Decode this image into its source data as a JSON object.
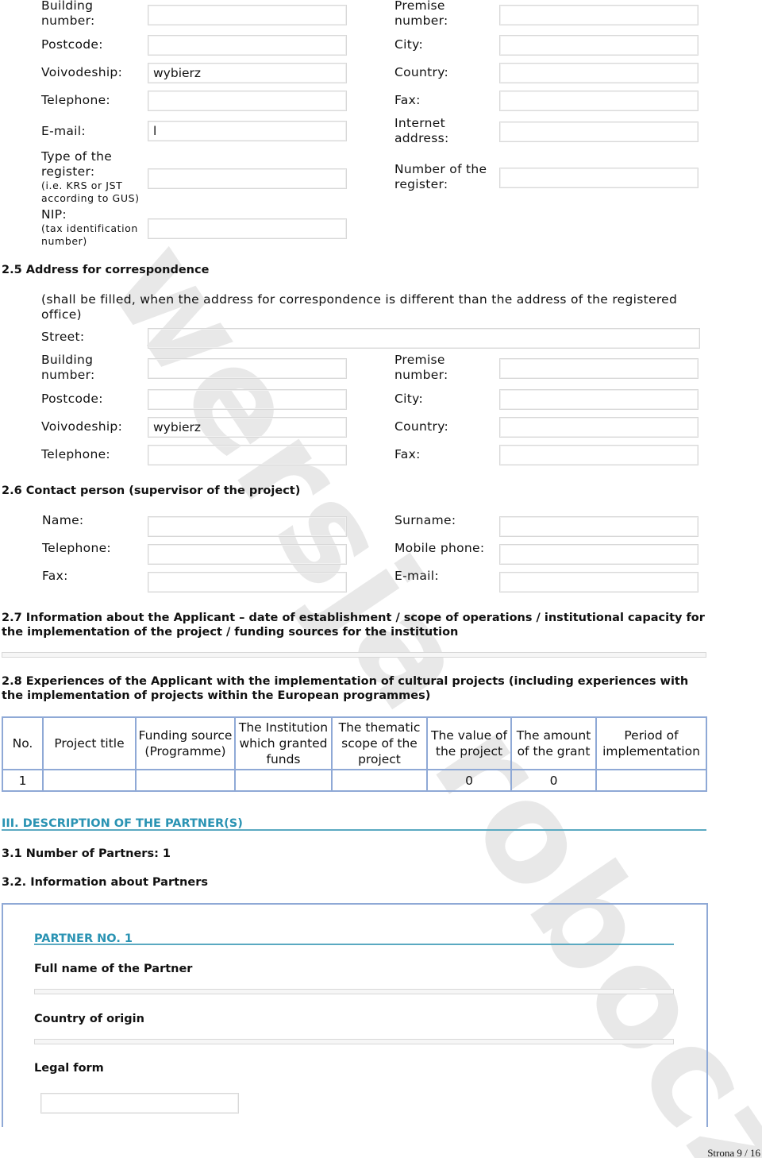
{
  "section_24": {
    "building_number": "Building number:",
    "premise_number": "Premise number:",
    "postcode": "Postcode:",
    "city": "City:",
    "voivodeship": "Voivodeship:",
    "voivodeship_value": "wybierz",
    "country": "Country:",
    "telephone": "Telephone:",
    "fax": "Fax:",
    "email": "E-mail:",
    "email_value": "l",
    "internet": "Internet address:",
    "register_type": "Type of the register:",
    "register_type_hint": "(i.e. KRS or JST according to GUS)",
    "register_number": "Number of the register:",
    "nip": "NIP:",
    "nip_hint": "(tax identification number)"
  },
  "section_25": {
    "heading": "2.5 Address for correspondence",
    "note": "(shall be filled, when the address for correspondence is different than the address of the registered office)",
    "street": "Street:",
    "building_number": "Building number:",
    "premise_number": "Premise number:",
    "postcode": "Postcode:",
    "city": "City:",
    "voivodeship": "Voivodeship:",
    "voivodeship_value": "wybierz",
    "country": "Country:",
    "telephone": "Telephone:",
    "fax": "Fax:"
  },
  "section_26": {
    "heading": "2.6 Contact person (supervisor of the project)",
    "name": "Name:",
    "surname": "Surname:",
    "telephone": "Telephone:",
    "mobile": "Mobile phone:",
    "fax": "Fax:",
    "email": "E-mail:"
  },
  "section_27": {
    "heading": "2.7 Information about the Applicant – date of establishment / scope of operations / institutional capacity for the implementation of the project / funding sources for the institution"
  },
  "section_28": {
    "heading": "2.8 Experiences of the Applicant with the implementation of cultural projects (including experiences with the implementation of projects within the European programmes)",
    "columns": [
      "No.",
      "Project title",
      "Funding source (Programme)",
      "The Institution which granted funds",
      "The thematic scope of the project",
      "The value of the project",
      "The amount of the grant",
      "Period of implementation"
    ],
    "rows": [
      [
        "1",
        "",
        "",
        "",
        "",
        "0",
        "0",
        ""
      ]
    ]
  },
  "section_3": {
    "heading": "III. DESCRIPTION OF THE PARTNER(S)",
    "partners_count": "3.1 Number of Partners: 1",
    "info_heading": "3.2. Information about Partners",
    "partner_title": "PARTNER NO. 1",
    "full_name": "Full name of the Partner",
    "country": "Country of origin",
    "legal_form": "Legal form"
  },
  "watermark": "wersja robocza",
  "footer": "Strona 9 / 16",
  "colors": {
    "accent": "#2a93b3",
    "table_border": "#8fa9d6"
  }
}
